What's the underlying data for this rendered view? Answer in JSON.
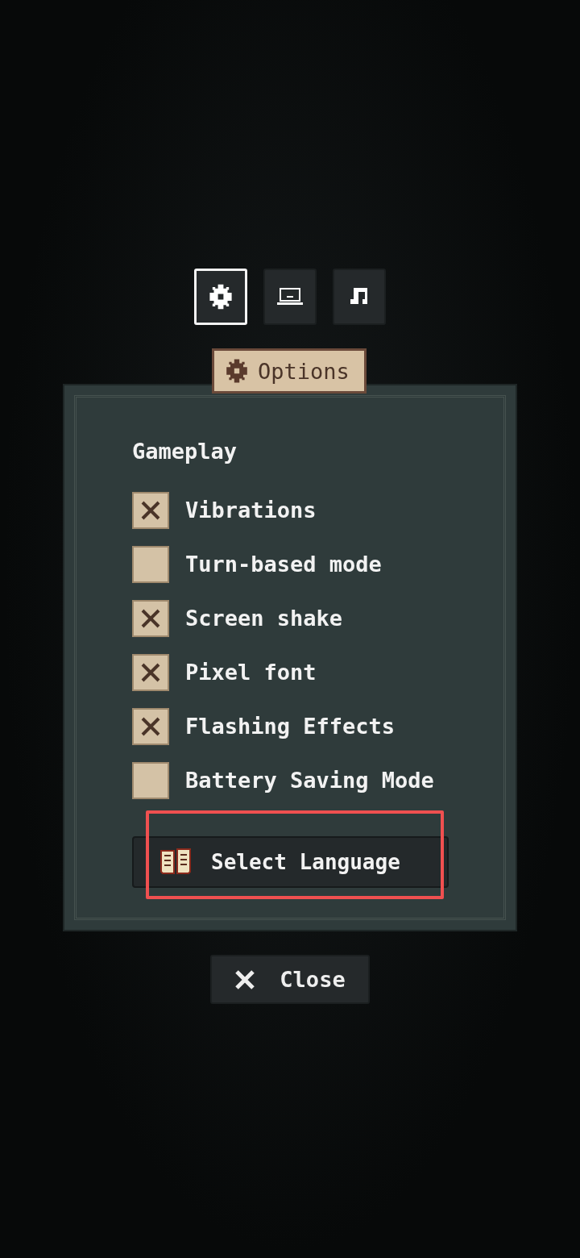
{
  "tabs": [
    {
      "kind": "settings",
      "selected": true
    },
    {
      "kind": "display",
      "selected": false
    },
    {
      "kind": "audio",
      "selected": false
    }
  ],
  "banner": {
    "title": "Options"
  },
  "section": {
    "title": "Gameplay"
  },
  "options": [
    {
      "label": "Vibrations",
      "checked": true
    },
    {
      "label": "Turn-based mode",
      "checked": false
    },
    {
      "label": "Screen shake",
      "checked": true
    },
    {
      "label": "Pixel font",
      "checked": true
    },
    {
      "label": "Flashing Effects",
      "checked": true
    },
    {
      "label": "Battery Saving Mode",
      "checked": false
    }
  ],
  "language_button": {
    "label": "Select Language",
    "highlighted": true
  },
  "close_button": {
    "label": "Close"
  }
}
